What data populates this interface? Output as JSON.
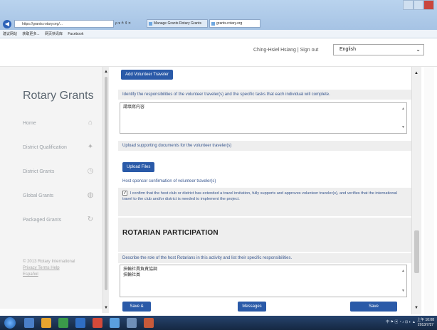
{
  "browser": {
    "address": "https://grants.rotary.org/...",
    "address_tools": "ρ ▾ ≜ ¢ ✕",
    "tabs": [
      "Manage Grants Rotary Grants",
      "grants.rotary.org"
    ],
    "favorites": [
      "建议网站",
      "获取更多...",
      "网页快讯库",
      "Facebook"
    ]
  },
  "header": {
    "user_name": "Ching-Hsiel Hsiang | Sign out",
    "language": "English"
  },
  "sidebar": {
    "brand": "Rotary Grants",
    "items": [
      {
        "label": "Home",
        "icon": "home-icon",
        "glyph": "⌂"
      },
      {
        "label": "District Qualification",
        "icon": "pin-icon",
        "glyph": "✦"
      },
      {
        "label": "District Grants",
        "icon": "clock-icon",
        "glyph": "◷"
      },
      {
        "label": "Global Grants",
        "icon": "globe-icon",
        "glyph": "◍"
      },
      {
        "label": "Packaged Grants",
        "icon": "refresh-icon",
        "glyph": "↻"
      }
    ],
    "footer": {
      "copyright": "© 2013 Rotary International",
      "links": "Privacy  Terms  Help",
      "extra": "Español"
    }
  },
  "main": {
    "add_volunteer_button": "Add Volunteer Traveler",
    "responsibilities_label": "Identify the responsibilities of the volunteer traveler(s) and the specific tasks that each individual will complete.",
    "responsibilities_value": "請填寫内容",
    "upload_label": "Upload supporting documents for the volunteer traveler(s)",
    "upload_button": "Upload Files",
    "host_sponsor_label": "Host sponsor confirmation of volunteer traveler(s)",
    "confirm_text": "I confirm that the host club or district has extended a travel invitation, fully supports and approves volunteer traveler(s), and verifies that the international travel to the club and/or district is needed to implement the project.",
    "confirm_checked": "✓",
    "section_title": "ROTARIAN PARTICIPATION",
    "role_label": "Describe the role of the host Rotarians in this activity and list their specific responsibilities.",
    "role_value_line1": "扶輪社員負責協調",
    "role_value_line2": "扶輪社員"
  },
  "actions": {
    "save_exit": "Save & Exit",
    "messages": "Messages",
    "save": "Save"
  },
  "taskbar": {
    "tray": "中 ⚑ ▣ ◔ ♪ ⊡ ◐ ▲",
    "time": "上午 10:08",
    "date": "2013/7/27"
  }
}
